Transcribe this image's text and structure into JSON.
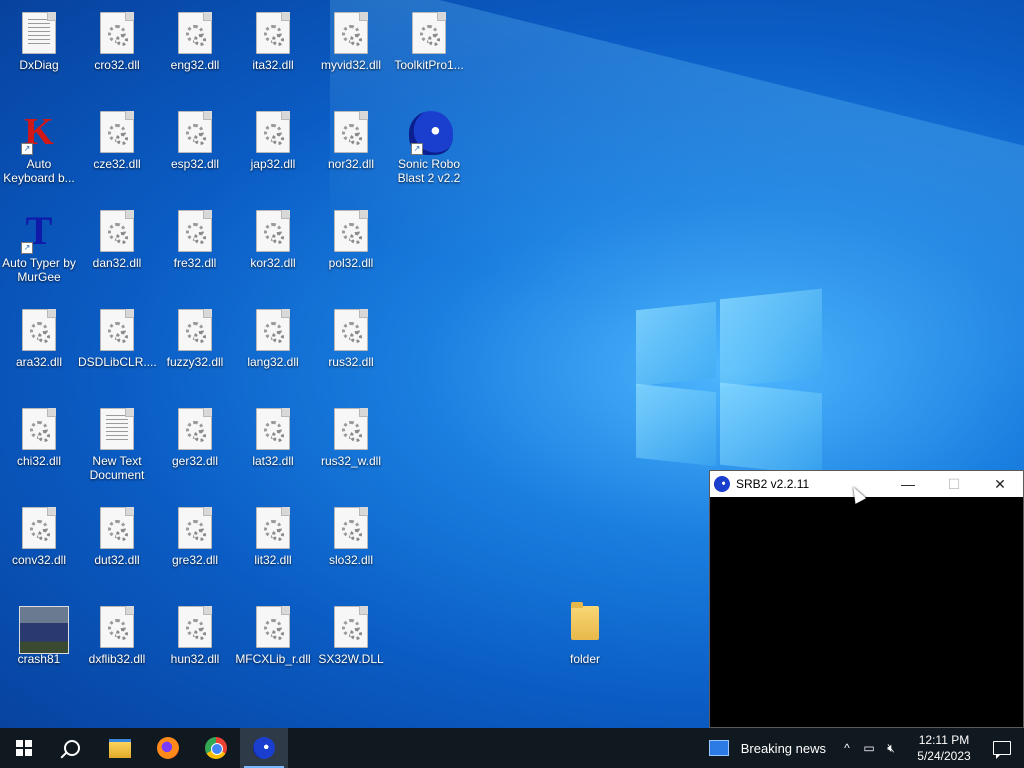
{
  "desktop_icons": [
    {
      "label": "DxDiag",
      "type": "doc"
    },
    {
      "label": "cro32.dll",
      "type": "dll"
    },
    {
      "label": "eng32.dll",
      "type": "dll"
    },
    {
      "label": "ita32.dll",
      "type": "dll"
    },
    {
      "label": "myvid32.dll",
      "type": "dll"
    },
    {
      "label": "ToolkitPro1...",
      "type": "dll"
    },
    {
      "label": "Auto Keyboard b...",
      "type": "autokeyboard"
    },
    {
      "label": "cze32.dll",
      "type": "dll"
    },
    {
      "label": "esp32.dll",
      "type": "dll"
    },
    {
      "label": "jap32.dll",
      "type": "dll"
    },
    {
      "label": "nor32.dll",
      "type": "dll"
    },
    {
      "label": "Sonic Robo Blast 2 v2.2",
      "type": "sonic"
    },
    {
      "label": "Auto Typer by MurGee",
      "type": "autotyper"
    },
    {
      "label": "dan32.dll",
      "type": "dll"
    },
    {
      "label": "fre32.dll",
      "type": "dll"
    },
    {
      "label": "kor32.dll",
      "type": "dll"
    },
    {
      "label": "pol32.dll",
      "type": "dll"
    },
    {
      "label": "ara32.dll",
      "type": "dll"
    },
    {
      "label": "DSDLibCLR....",
      "type": "dll"
    },
    {
      "label": "fuzzy32.dll",
      "type": "dll"
    },
    {
      "label": "lang32.dll",
      "type": "dll"
    },
    {
      "label": "rus32.dll",
      "type": "dll"
    },
    {
      "label": "chi32.dll",
      "type": "dll"
    },
    {
      "label": "New Text Document",
      "type": "doc"
    },
    {
      "label": "ger32.dll",
      "type": "dll"
    },
    {
      "label": "lat32.dll",
      "type": "dll"
    },
    {
      "label": "rus32_w.dll",
      "type": "dll"
    },
    {
      "label": "conv32.dll",
      "type": "dll"
    },
    {
      "label": "dut32.dll",
      "type": "dll"
    },
    {
      "label": "gre32.dll",
      "type": "dll"
    },
    {
      "label": "lit32.dll",
      "type": "dll"
    },
    {
      "label": "slo32.dll",
      "type": "dll"
    },
    {
      "label": "crash81",
      "type": "truck"
    },
    {
      "label": "dxflib32.dll",
      "type": "dll"
    },
    {
      "label": "hun32.dll",
      "type": "dll"
    },
    {
      "label": "MFCXLib_r.dll",
      "type": "dll"
    },
    {
      "label": "SX32W.DLL",
      "type": "dll"
    },
    {
      "label": "folder",
      "type": "folder"
    }
  ],
  "window": {
    "title": "SRB2 v2.2.11",
    "minimize_icon": "minimize-icon",
    "maximize_icon": "maximize-icon",
    "close_icon": "close-icon"
  },
  "taskbar": {
    "news_label": "Breaking news",
    "time": "12:11 PM",
    "date": "5/24/2023",
    "tray_chevron": "^",
    "apps": [
      "start-icon",
      "search-icon",
      "file-explorer-icon",
      "firefox-icon",
      "chrome-icon",
      "srb2-icon"
    ]
  }
}
